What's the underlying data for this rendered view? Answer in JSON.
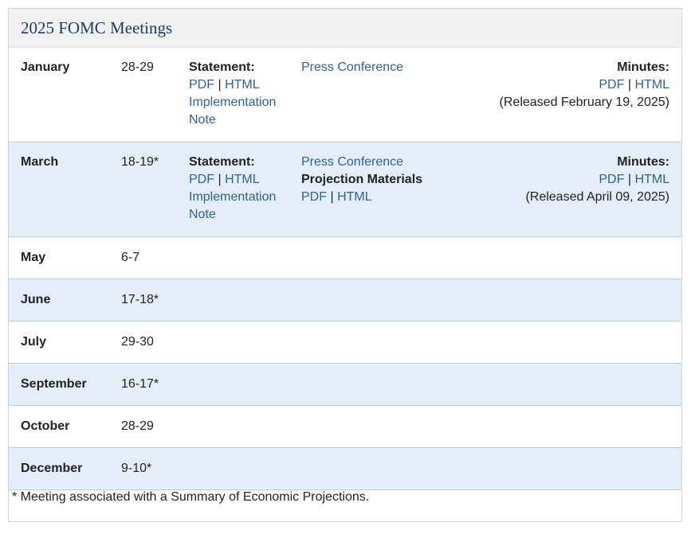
{
  "title": "2025 FOMC Meetings",
  "meetings": [
    {
      "month": "January",
      "dates": "28-29",
      "statement_label": "Statement:",
      "pdf": "PDF",
      "sep": "|",
      "html": "HTML",
      "impl": "Implementation Note",
      "press": "Press Conference",
      "minutes_label": "Minutes:",
      "min_pdf": "PDF",
      "min_html": "HTML",
      "released": "(Released February 19, 2025)"
    },
    {
      "month": "March",
      "dates": "18-19*",
      "statement_label": "Statement:",
      "pdf": "PDF",
      "sep": "|",
      "html": "HTML",
      "impl": "Implementation Note",
      "press": "Press Conference",
      "proj_label": "Projection Materials",
      "proj_pdf": "PDF",
      "proj_html": "HTML",
      "minutes_label": "Minutes:",
      "min_pdf": "PDF",
      "min_html": "HTML",
      "released": "(Released April 09, 2025)"
    },
    {
      "month": "May",
      "dates": "6-7"
    },
    {
      "month": "June",
      "dates": "17-18*"
    },
    {
      "month": "July",
      "dates": "29-30"
    },
    {
      "month": "September",
      "dates": "16-17*"
    },
    {
      "month": "October",
      "dates": "28-29"
    },
    {
      "month": "December",
      "dates": "9-10*"
    }
  ],
  "footnote": "* Meeting associated with a Summary of Economic Projections."
}
